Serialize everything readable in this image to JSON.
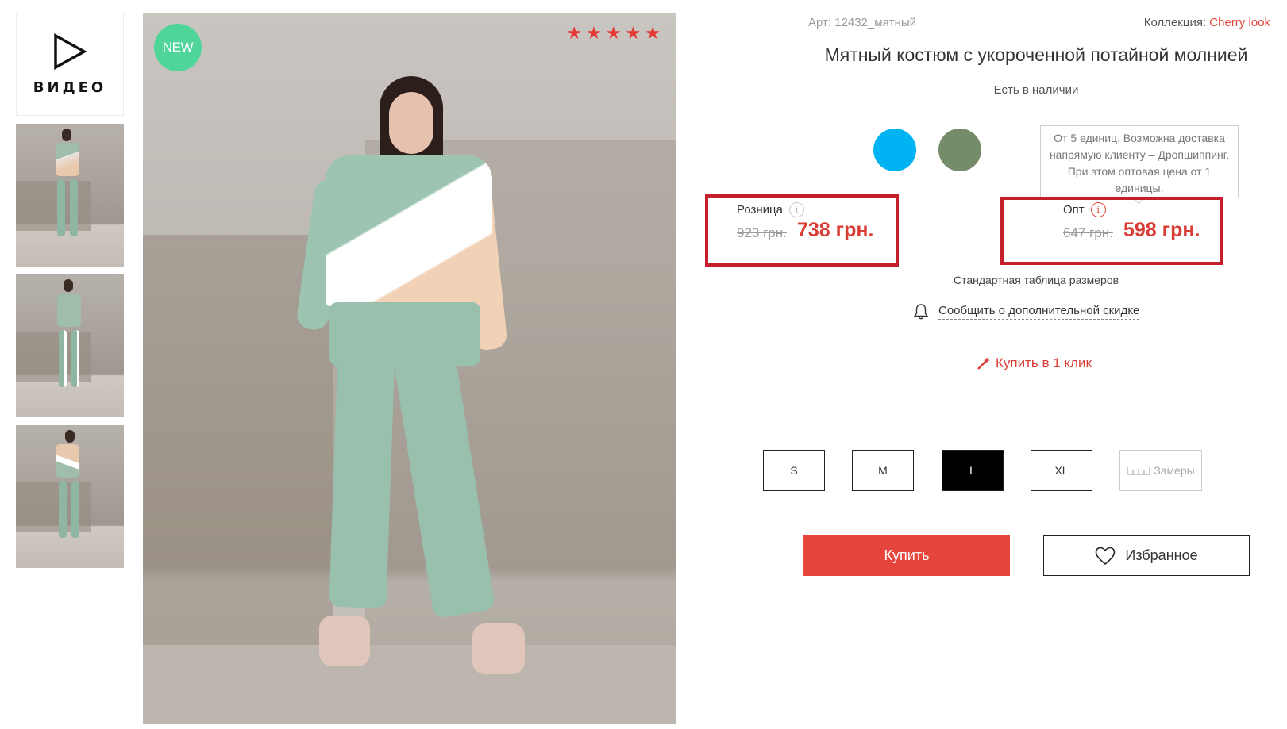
{
  "gallery": {
    "video_label": "ВИДЕО",
    "badge": "NEW",
    "stars": [
      "★",
      "★",
      "★",
      "★",
      "★"
    ],
    "thumbnails": [
      {
        "top_color": "#9fbdab"
      },
      {
        "top_color": "#9fbdab"
      },
      {
        "top_color": "#e8c9ad"
      }
    ]
  },
  "product": {
    "sku": "Арт: 12432_мятный",
    "collection_label": "Коллекция:",
    "collection_name": "Cherry look",
    "title": "Мятный костюм с укороченной потайной молнией",
    "stock": "Есть в наличии",
    "colors": [
      "#00b4f4",
      "#758c68"
    ],
    "tooltip": "От 5 единиц. Возможна доставка напрямую клиенту – Дропшиппинг. При этом оптовая цена от 1 единицы.",
    "retail": {
      "label": "Розница",
      "info_icon": "i",
      "old_price": "923 грн.",
      "price": "738 грн."
    },
    "wholesale": {
      "label": "Опт",
      "info_icon": "i",
      "old_price": "647 грн.",
      "price": "598 грн."
    },
    "size_table": "Стандартная таблица размеров",
    "notify": "Сообщить о дополнительной скидке",
    "quick_buy": "Купить в 1 клик",
    "sizes": [
      "S",
      "M",
      "L",
      "XL"
    ],
    "selected_size": "L",
    "measurements": "Замеры",
    "buy_button": "Купить",
    "favorite_button": "Избранное"
  },
  "colors": {
    "accent": "#e5453b",
    "highlight_border": "#c4202c",
    "badge": "#4fd49a"
  }
}
